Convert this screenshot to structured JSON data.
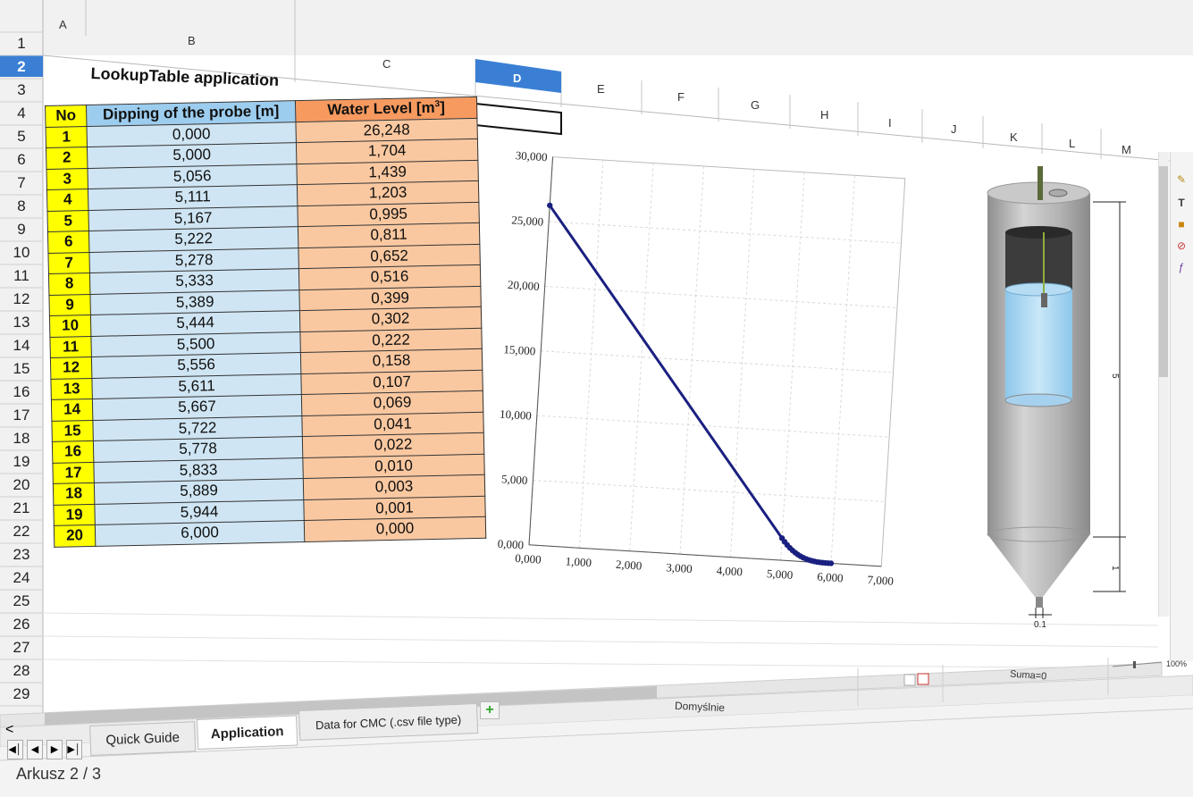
{
  "columns": [
    "A",
    "B",
    "C",
    "D",
    "E",
    "F",
    "G",
    "H",
    "I",
    "J",
    "K",
    "L",
    "M"
  ],
  "rows": [
    "1",
    "2",
    "3",
    "4",
    "5",
    "6",
    "7",
    "8",
    "9",
    "10",
    "11",
    "12",
    "13",
    "14",
    "15",
    "16",
    "17",
    "18",
    "19",
    "20",
    "21",
    "22",
    "23",
    "24",
    "25",
    "26",
    "27",
    "28",
    "29"
  ],
  "selected_row": "2",
  "selected_column": "D",
  "title": "LookupTable application",
  "table": {
    "headers": {
      "no": "No",
      "dipping": "Dipping of the probe [m]",
      "water_level": "Water Level [m",
      "water_level_sup": "3",
      "water_level_close": "]"
    },
    "rows": [
      {
        "no": "1",
        "dipping": "0,000",
        "level": "26,248"
      },
      {
        "no": "2",
        "dipping": "5,000",
        "level": "1,704"
      },
      {
        "no": "3",
        "dipping": "5,056",
        "level": "1,439"
      },
      {
        "no": "4",
        "dipping": "5,111",
        "level": "1,203"
      },
      {
        "no": "5",
        "dipping": "5,167",
        "level": "0,995"
      },
      {
        "no": "6",
        "dipping": "5,222",
        "level": "0,811"
      },
      {
        "no": "7",
        "dipping": "5,278",
        "level": "0,652"
      },
      {
        "no": "8",
        "dipping": "5,333",
        "level": "0,516"
      },
      {
        "no": "9",
        "dipping": "5,389",
        "level": "0,399"
      },
      {
        "no": "10",
        "dipping": "5,444",
        "level": "0,302"
      },
      {
        "no": "11",
        "dipping": "5,500",
        "level": "0,222"
      },
      {
        "no": "12",
        "dipping": "5,556",
        "level": "0,158"
      },
      {
        "no": "13",
        "dipping": "5,611",
        "level": "0,107"
      },
      {
        "no": "14",
        "dipping": "5,667",
        "level": "0,069"
      },
      {
        "no": "15",
        "dipping": "5,722",
        "level": "0,041"
      },
      {
        "no": "16",
        "dipping": "5,778",
        "level": "0,022"
      },
      {
        "no": "17",
        "dipping": "5,833",
        "level": "0,010"
      },
      {
        "no": "18",
        "dipping": "5,889",
        "level": "0,003"
      },
      {
        "no": "19",
        "dipping": "5,944",
        "level": "0,001"
      },
      {
        "no": "20",
        "dipping": "6,000",
        "level": "0,000"
      }
    ]
  },
  "chart_data": {
    "type": "line",
    "title": "",
    "xlabel": "",
    "ylabel": "",
    "xlim": [
      0,
      7
    ],
    "ylim": [
      0,
      30
    ],
    "x_ticks": [
      "0,000",
      "1,000",
      "2,000",
      "3,000",
      "4,000",
      "5,000",
      "6,000",
      "7,000"
    ],
    "y_ticks": [
      "0,000",
      "5,000",
      "10,000",
      "15,000",
      "20,000",
      "25,000",
      "30,000"
    ],
    "grid": true,
    "legend": "none",
    "series_color": "#1a2080",
    "series": [
      {
        "x": [
          0.0,
          5.0,
          5.056,
          5.111,
          5.167,
          5.222,
          5.278,
          5.333,
          5.389,
          5.444,
          5.5,
          5.556,
          5.611,
          5.667,
          5.722,
          5.778,
          5.833,
          5.889,
          5.944,
          6.0
        ],
        "y": [
          26.248,
          1.704,
          1.439,
          1.203,
          0.995,
          0.811,
          0.652,
          0.516,
          0.399,
          0.302,
          0.222,
          0.158,
          0.107,
          0.069,
          0.041,
          0.022,
          0.01,
          0.003,
          0.001,
          0.0
        ]
      }
    ]
  },
  "tank": {
    "dim_height": "5",
    "dim_cone": "1",
    "dim_outlet": "0.1"
  },
  "sheet_tabs": [
    "Quick Guide",
    "Application",
    "Data for CMC (.csv file type)"
  ],
  "active_tab": "Application",
  "status": {
    "sheet": "Arkusz 2 / 3",
    "style": "Domyślnie",
    "sum": "Suma=0",
    "zoom": "100%"
  },
  "icons": [
    "scroll-left-icon",
    "first-sheet-icon",
    "prev-sheet-icon",
    "next-sheet-icon",
    "last-sheet-icon",
    "add-sheet-icon"
  ]
}
